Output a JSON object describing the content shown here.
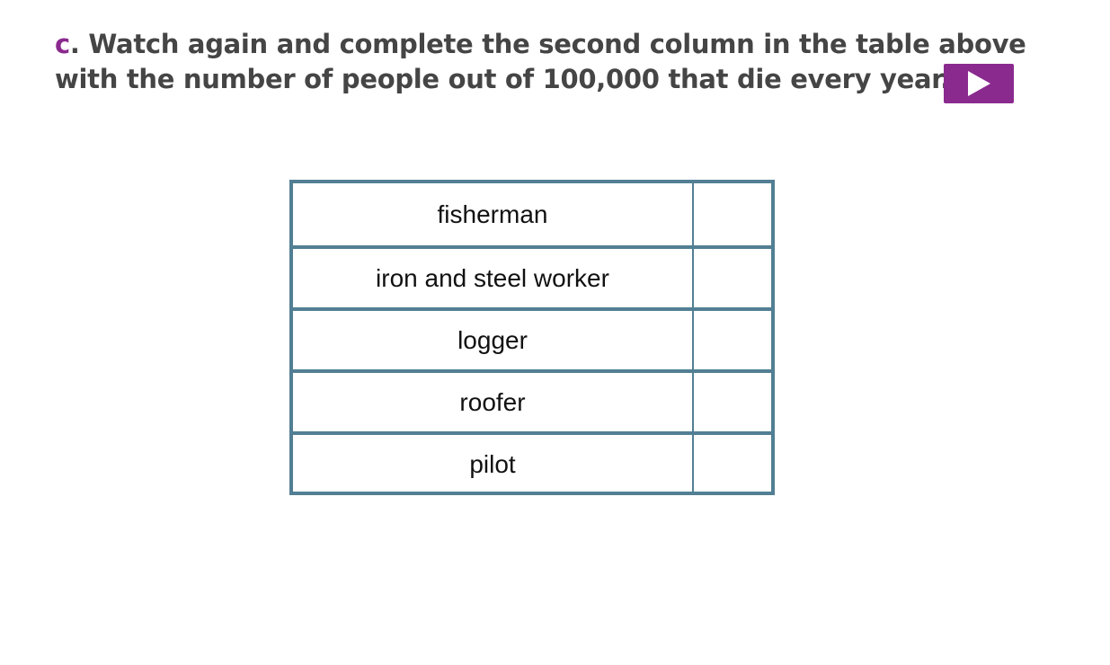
{
  "instruction": {
    "letter": "c",
    "separator": ".",
    "line1": " Watch again and complete the second column in the table above",
    "line2": "with the number of people out of 100,000 that die every year."
  },
  "play_button": {
    "icon": "play-icon",
    "color": "#8a2a8e"
  },
  "table": {
    "border_color": "#527f94",
    "rows": [
      {
        "occupation": "fisherman",
        "answer": ""
      },
      {
        "occupation": "iron and steel worker",
        "answer": ""
      },
      {
        "occupation": "logger",
        "answer": ""
      },
      {
        "occupation": "roofer",
        "answer": ""
      },
      {
        "occupation": "pilot",
        "answer": ""
      }
    ]
  }
}
